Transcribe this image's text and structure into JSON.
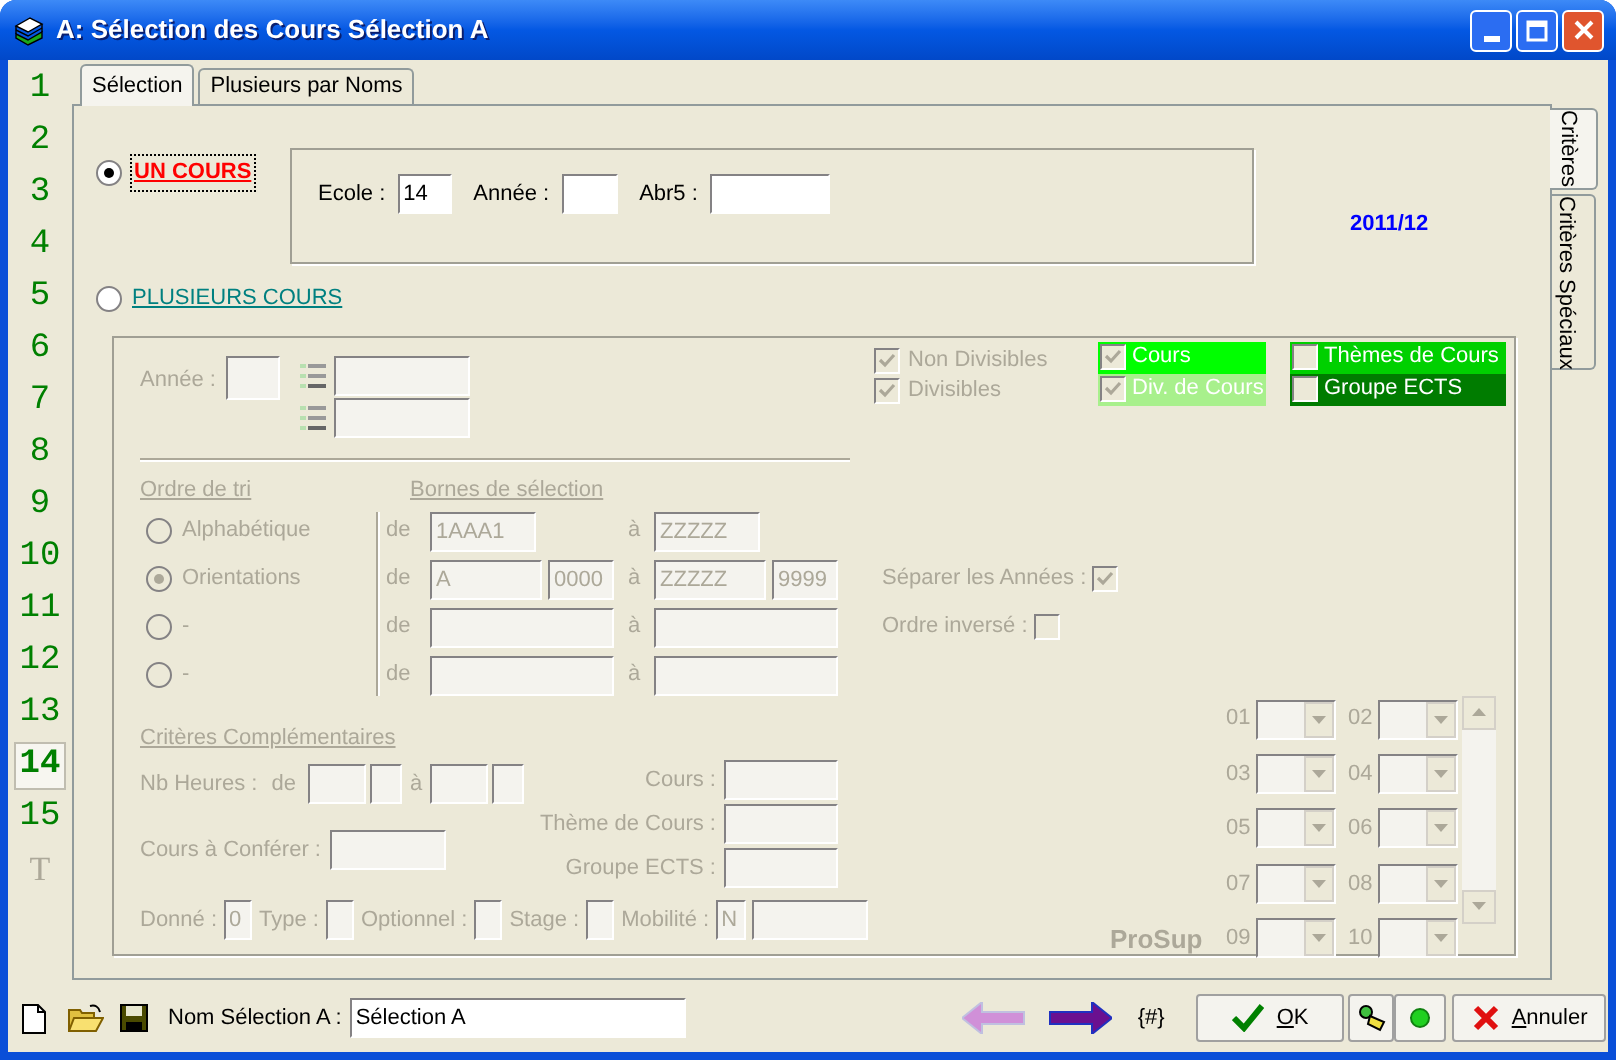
{
  "window": {
    "title": "A: Sélection des Cours Sélection A"
  },
  "line_numbers": [
    {
      "label": "1",
      "selected": false,
      "disabled": false
    },
    {
      "label": "2",
      "selected": false,
      "disabled": false
    },
    {
      "label": "3",
      "selected": false,
      "disabled": false
    },
    {
      "label": "4",
      "selected": false,
      "disabled": false
    },
    {
      "label": "5",
      "selected": false,
      "disabled": false
    },
    {
      "label": "6",
      "selected": false,
      "disabled": false
    },
    {
      "label": "7",
      "selected": false,
      "disabled": false
    },
    {
      "label": "8",
      "selected": false,
      "disabled": false
    },
    {
      "label": "9",
      "selected": false,
      "disabled": false
    },
    {
      "label": "10",
      "selected": false,
      "disabled": false
    },
    {
      "label": "11",
      "selected": false,
      "disabled": false
    },
    {
      "label": "12",
      "selected": false,
      "disabled": false
    },
    {
      "label": "13",
      "selected": false,
      "disabled": false
    },
    {
      "label": "14",
      "selected": true,
      "disabled": false
    },
    {
      "label": "15",
      "selected": false,
      "disabled": false
    },
    {
      "label": "T",
      "selected": false,
      "disabled": true
    }
  ],
  "tabs": [
    {
      "label": "Sélection",
      "selected": true
    },
    {
      "label": "Plusieurs par Noms",
      "selected": false
    }
  ],
  "side_tabs": [
    {
      "label": "Critères",
      "selected": true
    },
    {
      "label": "Critères Spéciaux",
      "selected": false
    }
  ],
  "modes": [
    {
      "label": "UN COURS",
      "selected": true
    },
    {
      "label": "PLUSIEURS COURS",
      "selected": false
    }
  ],
  "single": {
    "fields": [
      {
        "label": "Ecole :",
        "value": "14"
      },
      {
        "label": "Année :"
      },
      {
        "label": "Abr5 :"
      }
    ]
  },
  "period": "2011/12",
  "multiple": {
    "disabled": true,
    "year_label": "Année :",
    "divisibility": [
      {
        "label": "Non Divisibles",
        "checked": true
      },
      {
        "label": "Divisibles",
        "checked": true
      }
    ],
    "types": [
      {
        "label": "Cours",
        "checked": true,
        "color": "#00ff00"
      },
      {
        "label": "Div. de Cours",
        "checked": true,
        "color": "#a8f08c"
      },
      {
        "label": "Thèmes de Cours",
        "checked": false,
        "color": "#00d000"
      },
      {
        "label": "Groupe ECTS",
        "checked": false,
        "color": "#007c00"
      }
    ],
    "sort_title": "Ordre de tri",
    "bounds_title": "Bornes de sélection",
    "sort_rows": [
      {
        "label": "Alphabétique",
        "selected": false,
        "kind": "single",
        "from_label": "de",
        "to_label": "à",
        "from": [
          "1AAA1"
        ],
        "to": [
          "ZZZZZ"
        ]
      },
      {
        "label": "Orientations",
        "selected": true,
        "kind": "split",
        "from_label": "de",
        "to_label": "à",
        "from": [
          "A",
          "0000"
        ],
        "to": [
          "ZZZZZ",
          "9999"
        ]
      },
      {
        "label": "-",
        "selected": false,
        "kind": "wide",
        "from_label": "de",
        "to_label": "à"
      },
      {
        "label": "-",
        "selected": false,
        "kind": "wide",
        "from_label": "de",
        "to_label": "à"
      }
    ],
    "options": [
      {
        "label": "Séparer les Années :",
        "checked": true
      },
      {
        "label": "Ordre inversé :",
        "checked": false
      }
    ],
    "extra_title": "Critères Complémentaires",
    "hours": {
      "label": "Nb Heures :",
      "from_label": "de",
      "to_label": "à"
    },
    "confer_label": "Cours à Conférer :",
    "links": [
      {
        "label": "Cours :"
      },
      {
        "label": "Thème de Cours :"
      },
      {
        "label": "Groupe ECTS :"
      }
    ],
    "flags": [
      {
        "label": "Donné :",
        "value": "0",
        "kind": "single"
      },
      {
        "label": "Type :",
        "kind": "single"
      },
      {
        "label": "Optionnel :",
        "kind": "single"
      },
      {
        "label": "Stage :",
        "kind": "single"
      },
      {
        "label": "Mobilité :",
        "value": "N",
        "kind": "double"
      }
    ],
    "slots": [
      "01",
      "02",
      "03",
      "04",
      "05",
      "06",
      "07",
      "08",
      "09",
      "10"
    ],
    "brand": "ProSup"
  },
  "footer": {
    "name_label": "Nom Sélection A :",
    "name_value": "Sélection A",
    "nav": [
      {
        "kind": "back",
        "disabled": true
      },
      {
        "kind": "forward",
        "disabled": false
      }
    ],
    "counter": "{#}",
    "ok": "OK",
    "cancel": "Annuler"
  }
}
